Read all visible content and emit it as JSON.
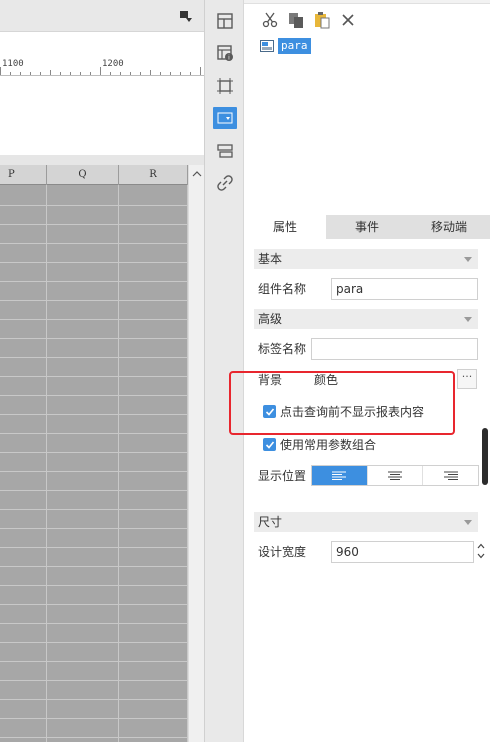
{
  "ruler": {
    "marks": [
      "1100",
      "1200"
    ]
  },
  "sheet": {
    "columns": [
      "P",
      "Q",
      "R"
    ]
  },
  "widget_tree": {
    "selected_item": "para"
  },
  "tabs": [
    {
      "label": "属性",
      "active": true
    },
    {
      "label": "事件",
      "active": false
    },
    {
      "label": "移动端",
      "active": false
    }
  ],
  "sections": {
    "basic": "基本",
    "advanced": "高级",
    "size": "尺寸"
  },
  "fields": {
    "component_name_label": "组件名称",
    "component_name_value": "para",
    "tag_name_label": "标签名称",
    "tag_name_value": "",
    "background_label": "背景",
    "background_value": "颜色",
    "background_more": "···",
    "hide_before_query_label": "点击查询前不显示报表内容",
    "use_common_params_label": "使用常用参数组合",
    "display_position_label": "显示位置",
    "design_width_label": "设计宽度",
    "design_width_value": "960"
  },
  "checkboxes": {
    "hide_before_query": true,
    "use_common_params": true
  },
  "display_position_selected": "left",
  "colors": {
    "accent": "#3d8fe0",
    "highlight": "#e8262e"
  }
}
